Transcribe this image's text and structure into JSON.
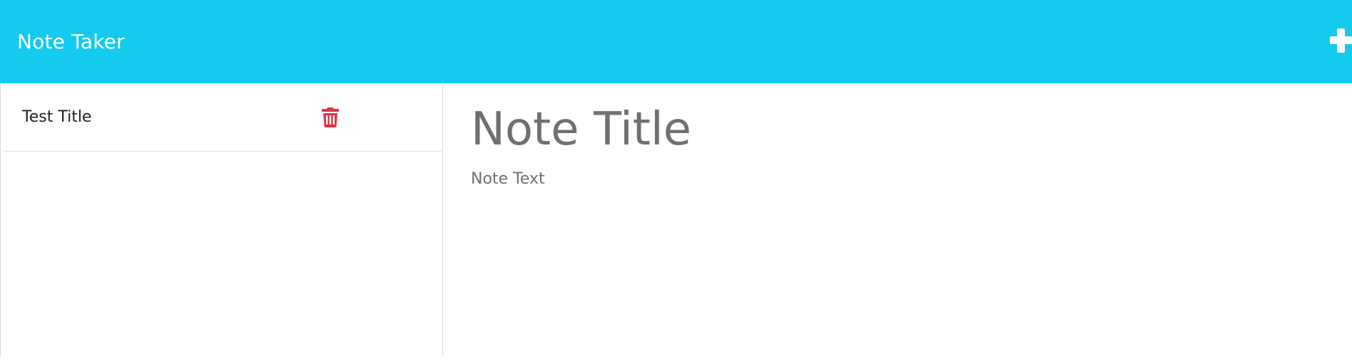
{
  "navbar": {
    "brand": "Note Taker",
    "background_color": "#14caef",
    "new_note_icon": "plus-icon"
  },
  "sidebar": {
    "notes": [
      {
        "title": "Test Title",
        "delete_icon": "trash-icon",
        "delete_color": "#dc3545"
      }
    ]
  },
  "editor": {
    "title_placeholder": "Note Title",
    "text_placeholder": "Note Text"
  }
}
